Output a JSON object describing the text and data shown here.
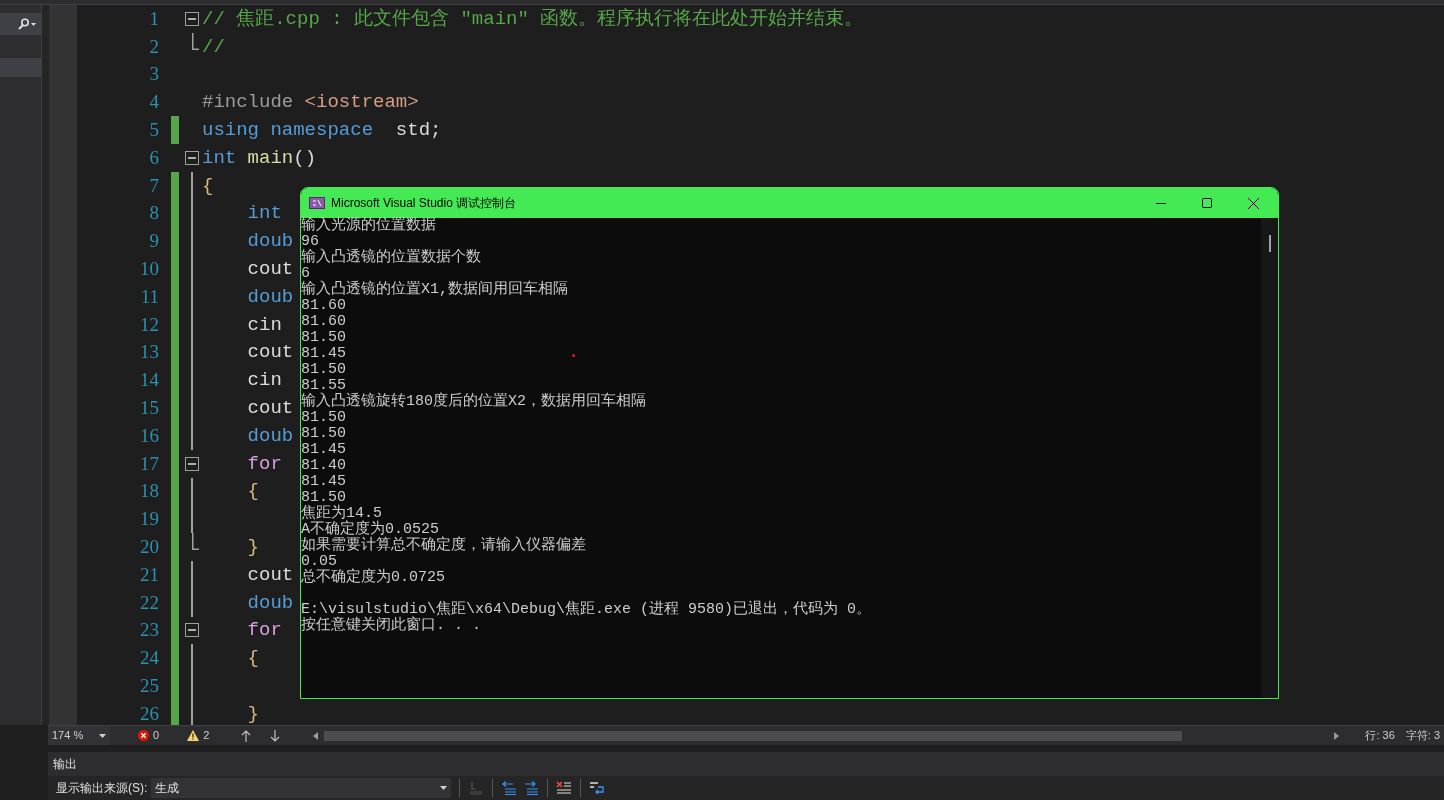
{
  "editor": {
    "lines": [
      {
        "number": "1",
        "fold_start": true,
        "fold_end": false,
        "changed": false,
        "tokens": [
          {
            "kind": "comment",
            "text": "// 焦距.cpp : 此文件包含 \"main\" 函数。程序执行将在此处开始并结束。"
          }
        ]
      },
      {
        "number": "2",
        "fold_start": false,
        "fold_end": true,
        "changed": false,
        "tokens": [
          {
            "kind": "comment",
            "text": "//"
          }
        ]
      },
      {
        "number": "3",
        "fold_start": false,
        "fold_end": false,
        "changed": false
      },
      {
        "number": "4",
        "fold_start": false,
        "fold_end": false,
        "changed": false,
        "tokens": [
          {
            "kind": "preproc",
            "text": "#include"
          },
          {
            "kind": "string",
            "text": " <iostream>"
          }
        ]
      },
      {
        "number": "5",
        "fold_start": false,
        "fold_end": false,
        "changed": true,
        "tokens": [
          {
            "kind": "keyword",
            "text": "using"
          },
          {
            "kind": "keyword",
            "text": " namespace"
          },
          {
            "kind": "plain",
            "text": "  std;"
          }
        ]
      },
      {
        "number": "6",
        "fold_start": true,
        "fold_end": false,
        "changed": false,
        "tokens": [
          {
            "kind": "keyword",
            "text": "int"
          },
          {
            "kind": "function",
            "text": " main"
          },
          {
            "kind": "plain",
            "text": "()"
          }
        ]
      },
      {
        "number": "7",
        "fold_start": false,
        "fold_end": false,
        "changed": true,
        "tokens": [
          {
            "kind": "brace",
            "text": "{"
          }
        ]
      },
      {
        "number": "8",
        "fold_start": false,
        "fold_end": false,
        "changed": true,
        "tokens": [
          {
            "kind": "keyword",
            "text": "    int"
          }
        ]
      },
      {
        "number": "9",
        "fold_start": false,
        "fold_end": false,
        "changed": true,
        "tokens": [
          {
            "kind": "keyword",
            "text": "    doub"
          }
        ]
      },
      {
        "number": "10",
        "fold_start": false,
        "fold_end": false,
        "changed": true,
        "tokens": [
          {
            "kind": "plain",
            "text": "    cout"
          }
        ]
      },
      {
        "number": "11",
        "fold_start": false,
        "fold_end": false,
        "changed": true,
        "tokens": [
          {
            "kind": "keyword",
            "text": "    doub"
          }
        ]
      },
      {
        "number": "12",
        "fold_start": false,
        "fold_end": false,
        "changed": true,
        "tokens": [
          {
            "kind": "plain",
            "text": "    cin"
          }
        ]
      },
      {
        "number": "13",
        "fold_start": false,
        "fold_end": false,
        "changed": true,
        "tokens": [
          {
            "kind": "plain",
            "text": "    cout"
          }
        ]
      },
      {
        "number": "14",
        "fold_start": false,
        "fold_end": false,
        "changed": true,
        "tokens": [
          {
            "kind": "plain",
            "text": "    cin"
          }
        ]
      },
      {
        "number": "15",
        "fold_start": false,
        "fold_end": false,
        "changed": true,
        "tokens": [
          {
            "kind": "plain",
            "text": "    cout"
          }
        ]
      },
      {
        "number": "16",
        "fold_start": false,
        "fold_end": false,
        "changed": true,
        "tokens": [
          {
            "kind": "keyword",
            "text": "    doub"
          }
        ]
      },
      {
        "number": "17",
        "fold_start": true,
        "fold_end": false,
        "changed": true,
        "tokens": [
          {
            "kind": "control",
            "text": "    for"
          }
        ]
      },
      {
        "number": "18",
        "fold_start": false,
        "fold_end": false,
        "changed": true,
        "tokens": [
          {
            "kind": "brace",
            "text": "    {"
          }
        ]
      },
      {
        "number": "19",
        "fold_start": false,
        "fold_end": false,
        "changed": true
      },
      {
        "number": "20",
        "fold_start": false,
        "fold_end": true,
        "changed": true,
        "tokens": [
          {
            "kind": "brace",
            "text": "    }"
          }
        ]
      },
      {
        "number": "21",
        "fold_start": false,
        "fold_end": false,
        "changed": true,
        "tokens": [
          {
            "kind": "plain",
            "text": "    cout"
          }
        ]
      },
      {
        "number": "22",
        "fold_start": false,
        "fold_end": false,
        "changed": true,
        "tokens": [
          {
            "kind": "keyword",
            "text": "    doub"
          }
        ]
      },
      {
        "number": "23",
        "fold_start": true,
        "fold_end": false,
        "changed": true,
        "tokens": [
          {
            "kind": "control",
            "text": "    for"
          }
        ]
      },
      {
        "number": "24",
        "fold_start": false,
        "fold_end": false,
        "changed": true,
        "tokens": [
          {
            "kind": "brace",
            "text": "    {"
          }
        ]
      },
      {
        "number": "25",
        "fold_start": false,
        "fold_end": false,
        "changed": true
      },
      {
        "number": "26",
        "fold_start": false,
        "fold_end": false,
        "changed": true,
        "tokens": [
          {
            "kind": "brace",
            "text": "    }"
          }
        ]
      }
    ]
  },
  "console": {
    "title": "Microsoft Visual Studio 调试控制台",
    "lines": [
      {
        "kind": "text",
        "text": "输入光源的位置数据"
      },
      {
        "kind": "text",
        "text": "96"
      },
      {
        "kind": "text",
        "text": "输入凸透镜的位置数据个数"
      },
      {
        "kind": "text",
        "text": "6"
      },
      {
        "kind": "text",
        "text": "输入凸透镜的位置X1,数据间用回车相隔"
      },
      {
        "kind": "text",
        "text": "81.60"
      },
      {
        "kind": "text",
        "text": "81.60"
      },
      {
        "kind": "text",
        "text": "81.50"
      },
      {
        "kind": "text",
        "text": "81.45"
      },
      {
        "kind": "text",
        "text": "81.50"
      },
      {
        "kind": "text",
        "text": "81.55"
      },
      {
        "kind": "text",
        "text": "输入凸透镜旋转180度后的位置X2，数据用回车相隔"
      },
      {
        "kind": "text",
        "text": "81.50"
      },
      {
        "kind": "text",
        "text": "81.50"
      },
      {
        "kind": "text",
        "text": "81.45"
      },
      {
        "kind": "text",
        "text": "81.40"
      },
      {
        "kind": "text",
        "text": "81.45"
      },
      {
        "kind": "text",
        "text": "81.50"
      },
      {
        "kind": "text",
        "text": "焦距为14.5"
      },
      {
        "kind": "text",
        "text": "A不确定度为0.0525"
      },
      {
        "kind": "text",
        "text": "如果需要计算总不确定度，请输入仪器偏差"
      },
      {
        "kind": "text",
        "text": "0.05"
      },
      {
        "kind": "text",
        "text": "总不确定度为0.0725"
      },
      {
        "kind": "blank"
      },
      {
        "kind": "text",
        "text": "E:\\visulstudio\\焦距\\x64\\Debug\\焦距.exe (进程 9580)已退出，代码为 0。"
      },
      {
        "kind": "text",
        "text": "按任意键关闭此窗口. . ."
      }
    ]
  },
  "status_bar": {
    "zoom": "174 %",
    "errors": "0",
    "warnings": "2",
    "line": "行: 36",
    "column": "字符: 3"
  },
  "output_panel": {
    "title": "输出",
    "source_label": "显示输出来源(S):",
    "source": "生成"
  }
}
